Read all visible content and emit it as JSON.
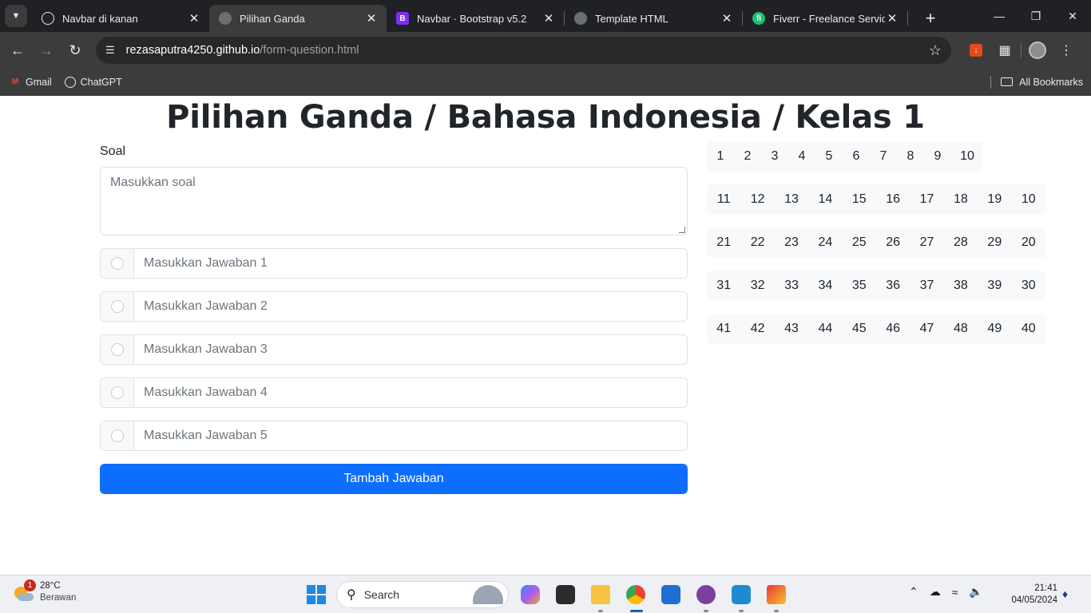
{
  "browser": {
    "tabs": [
      {
        "title": "Navbar di kanan",
        "favicon": "chatgpt-icon",
        "color": "#e8eaed"
      },
      {
        "title": "Pilihan Ganda",
        "favicon": "globe-icon",
        "color": "#9aa0a6"
      },
      {
        "title": "Navbar · Bootstrap v5.2",
        "favicon": "bootstrap-icon",
        "color": "#7b2ff7"
      },
      {
        "title": "Template HTML",
        "favicon": "globe-icon",
        "color": "#9aa0a6"
      },
      {
        "title": "Fiverr - Freelance Services M",
        "favicon": "fiverr-icon",
        "color": "#1dbf73"
      }
    ],
    "active_tab": 1,
    "url_host": "rezasaputra4250.github.io",
    "url_path": "/form-question.html",
    "bookmarks": [
      "Gmail",
      "ChatGPT"
    ],
    "all_bookmarks_label": "All Bookmarks"
  },
  "page": {
    "title": "Pilihan Ganda / Bahasa Indonesia / Kelas 1",
    "soal_label": "Soal",
    "soal_placeholder": "Masukkan soal",
    "answers": [
      "Masukkan Jawaban 1",
      "Masukkan Jawaban 2",
      "Masukkan Jawaban 3",
      "Masukkan Jawaban 4",
      "Masukkan Jawaban 5"
    ],
    "add_button": "Tambah Jawaban",
    "question_numbers": [
      [
        "1",
        "2",
        "3",
        "4",
        "5",
        "6",
        "7",
        "8",
        "9",
        "10"
      ],
      [
        "11",
        "12",
        "13",
        "14",
        "15",
        "16",
        "17",
        "18",
        "19",
        "10"
      ],
      [
        "21",
        "22",
        "23",
        "24",
        "25",
        "26",
        "27",
        "28",
        "29",
        "20"
      ],
      [
        "31",
        "32",
        "33",
        "34",
        "35",
        "36",
        "37",
        "38",
        "39",
        "30"
      ],
      [
        "41",
        "42",
        "43",
        "44",
        "45",
        "46",
        "47",
        "48",
        "49",
        "40"
      ]
    ],
    "accent_color": "#0d6efd"
  },
  "taskbar": {
    "weather_temp": "28°C",
    "weather_desc": "Berawan",
    "weather_badge": "1",
    "search_label": "Search",
    "time": "21:41",
    "date": "04/05/2024"
  }
}
